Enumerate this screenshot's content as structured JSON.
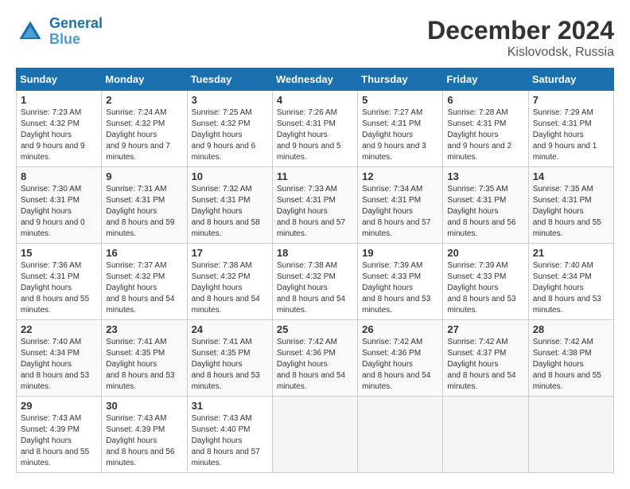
{
  "header": {
    "logo_line1": "General",
    "logo_line2": "Blue",
    "month_title": "December 2024",
    "location": "Kislovodsk, Russia"
  },
  "weekdays": [
    "Sunday",
    "Monday",
    "Tuesday",
    "Wednesday",
    "Thursday",
    "Friday",
    "Saturday"
  ],
  "weeks": [
    [
      {
        "day": "1",
        "sunrise": "7:23 AM",
        "sunset": "4:32 PM",
        "daylight": "9 hours and 9 minutes."
      },
      {
        "day": "2",
        "sunrise": "7:24 AM",
        "sunset": "4:32 PM",
        "daylight": "9 hours and 7 minutes."
      },
      {
        "day": "3",
        "sunrise": "7:25 AM",
        "sunset": "4:32 PM",
        "daylight": "9 hours and 6 minutes."
      },
      {
        "day": "4",
        "sunrise": "7:26 AM",
        "sunset": "4:31 PM",
        "daylight": "9 hours and 5 minutes."
      },
      {
        "day": "5",
        "sunrise": "7:27 AM",
        "sunset": "4:31 PM",
        "daylight": "9 hours and 3 minutes."
      },
      {
        "day": "6",
        "sunrise": "7:28 AM",
        "sunset": "4:31 PM",
        "daylight": "9 hours and 2 minutes."
      },
      {
        "day": "7",
        "sunrise": "7:29 AM",
        "sunset": "4:31 PM",
        "daylight": "9 hours and 1 minute."
      }
    ],
    [
      {
        "day": "8",
        "sunrise": "7:30 AM",
        "sunset": "4:31 PM",
        "daylight": "9 hours and 0 minutes."
      },
      {
        "day": "9",
        "sunrise": "7:31 AM",
        "sunset": "4:31 PM",
        "daylight": "8 hours and 59 minutes."
      },
      {
        "day": "10",
        "sunrise": "7:32 AM",
        "sunset": "4:31 PM",
        "daylight": "8 hours and 58 minutes."
      },
      {
        "day": "11",
        "sunrise": "7:33 AM",
        "sunset": "4:31 PM",
        "daylight": "8 hours and 57 minutes."
      },
      {
        "day": "12",
        "sunrise": "7:34 AM",
        "sunset": "4:31 PM",
        "daylight": "8 hours and 57 minutes."
      },
      {
        "day": "13",
        "sunrise": "7:35 AM",
        "sunset": "4:31 PM",
        "daylight": "8 hours and 56 minutes."
      },
      {
        "day": "14",
        "sunrise": "7:35 AM",
        "sunset": "4:31 PM",
        "daylight": "8 hours and 55 minutes."
      }
    ],
    [
      {
        "day": "15",
        "sunrise": "7:36 AM",
        "sunset": "4:31 PM",
        "daylight": "8 hours and 55 minutes."
      },
      {
        "day": "16",
        "sunrise": "7:37 AM",
        "sunset": "4:32 PM",
        "daylight": "8 hours and 54 minutes."
      },
      {
        "day": "17",
        "sunrise": "7:38 AM",
        "sunset": "4:32 PM",
        "daylight": "8 hours and 54 minutes."
      },
      {
        "day": "18",
        "sunrise": "7:38 AM",
        "sunset": "4:32 PM",
        "daylight": "8 hours and 54 minutes."
      },
      {
        "day": "19",
        "sunrise": "7:39 AM",
        "sunset": "4:33 PM",
        "daylight": "8 hours and 53 minutes."
      },
      {
        "day": "20",
        "sunrise": "7:39 AM",
        "sunset": "4:33 PM",
        "daylight": "8 hours and 53 minutes."
      },
      {
        "day": "21",
        "sunrise": "7:40 AM",
        "sunset": "4:34 PM",
        "daylight": "8 hours and 53 minutes."
      }
    ],
    [
      {
        "day": "22",
        "sunrise": "7:40 AM",
        "sunset": "4:34 PM",
        "daylight": "8 hours and 53 minutes."
      },
      {
        "day": "23",
        "sunrise": "7:41 AM",
        "sunset": "4:35 PM",
        "daylight": "8 hours and 53 minutes."
      },
      {
        "day": "24",
        "sunrise": "7:41 AM",
        "sunset": "4:35 PM",
        "daylight": "8 hours and 53 minutes."
      },
      {
        "day": "25",
        "sunrise": "7:42 AM",
        "sunset": "4:36 PM",
        "daylight": "8 hours and 54 minutes."
      },
      {
        "day": "26",
        "sunrise": "7:42 AM",
        "sunset": "4:36 PM",
        "daylight": "8 hours and 54 minutes."
      },
      {
        "day": "27",
        "sunrise": "7:42 AM",
        "sunset": "4:37 PM",
        "daylight": "8 hours and 54 minutes."
      },
      {
        "day": "28",
        "sunrise": "7:42 AM",
        "sunset": "4:38 PM",
        "daylight": "8 hours and 55 minutes."
      }
    ],
    [
      {
        "day": "29",
        "sunrise": "7:43 AM",
        "sunset": "4:39 PM",
        "daylight": "8 hours and 55 minutes."
      },
      {
        "day": "30",
        "sunrise": "7:43 AM",
        "sunset": "4:39 PM",
        "daylight": "8 hours and 56 minutes."
      },
      {
        "day": "31",
        "sunrise": "7:43 AM",
        "sunset": "4:40 PM",
        "daylight": "8 hours and 57 minutes."
      },
      null,
      null,
      null,
      null
    ]
  ]
}
